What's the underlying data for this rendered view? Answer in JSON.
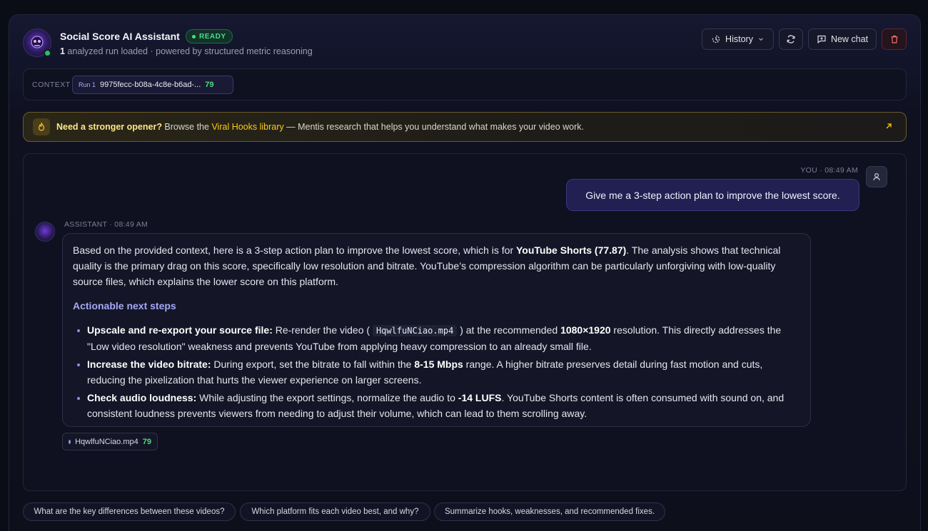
{
  "header": {
    "title": "Social Score AI Assistant",
    "status_badge": "READY",
    "subtitle_count": "1",
    "subtitle_rest": " analyzed run loaded · powered by structured metric reasoning",
    "history_label": "History",
    "new_chat_label": "New chat"
  },
  "context": {
    "label": "CONTEXT",
    "run_tag": "Run 1",
    "run_id": "9975fecc-b08a-4c8e-b6ad-...",
    "run_score": "79"
  },
  "banner": {
    "bold": "Need a stronger opener?",
    "pre_link": " Browse the ",
    "link": "Viral Hooks library",
    "post_link": " — Mentis research that helps you understand what makes your video work."
  },
  "chat": {
    "user": {
      "meta": "YOU · 08:49 AM",
      "message": "Give me a 3-step action plan to improve the lowest score."
    },
    "assistant": {
      "meta": "ASSISTANT · 08:49 AM",
      "intro_1": "Based on the provided context, here is a 3-step action plan to improve the lowest score, which is for ",
      "intro_bold": "YouTube Shorts (77.87)",
      "intro_2": ". The analysis shows that technical quality is the primary drag on this score, specifically low resolution and bitrate. YouTube’s compression algorithm can be particularly unforgiving with low-quality source files, which explains the lower score on this platform.",
      "steps_title": "Actionable next steps",
      "step1_bold": "Upscale and re-export your source file:",
      "step1_a": " Re-render the video ( ",
      "step1_code": "HqwlfuNCiao.mp4",
      "step1_b": " ) at the recommended ",
      "step1_res": "1080×1920",
      "step1_c": " resolution. This directly addresses the \"Low video resolution\" weakness and prevents YouTube from applying heavy compression to an already small file.",
      "step2_bold": "Increase the video bitrate:",
      "step2_a": " During export, set the bitrate to fall within the ",
      "step2_range": "8-15 Mbps",
      "step2_b": " range. A higher bitrate preserves detail during fast motion and cuts, reducing the pixelization that hurts the viewer experience on larger screens.",
      "step3_bold": "Check audio loudness:",
      "step3_a": " While adjusting the export settings, normalize the audio to ",
      "step3_lufs": "-14 LUFS",
      "step3_b": ". YouTube Shorts content is often consumed with sound on, and consistent loudness prevents viewers from needing to adjust their volume, which can lead to them scrolling away."
    },
    "file_chip": {
      "name": "HqwlfuNCiao.mp4",
      "score": "79"
    }
  },
  "suggestions": [
    "What are the key differences between these videos?",
    "Which platform fits each video best, and why?",
    "Summarize hooks, weaknesses, and recommended fixes."
  ],
  "colors": {
    "accent": "#8b8ef0",
    "ready": "#4ade80",
    "banner_link": "#facc15",
    "danger": "#f87171"
  }
}
